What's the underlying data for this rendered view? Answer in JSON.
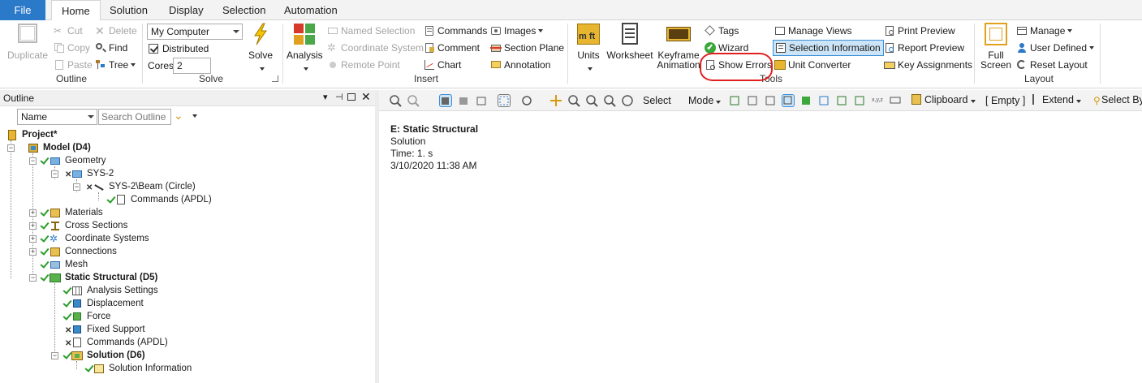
{
  "tabs": [
    "File",
    "Home",
    "Solution",
    "Display",
    "Selection",
    "Automation"
  ],
  "ribbon": {
    "outline_group": {
      "label": "Outline",
      "duplicate": "Duplicate",
      "cut": "Cut",
      "copy": "Copy",
      "paste": "Paste",
      "delete": "Delete",
      "find": "Find",
      "tree": "Tree"
    },
    "solve_group": {
      "label": "Solve",
      "computer_value": "My Computer",
      "distributed_label": "Distributed",
      "distributed_checked": true,
      "cores_label": "Cores",
      "cores_value": "2",
      "solve": "Solve"
    },
    "insert_group": {
      "label": "Insert",
      "analysis": "Analysis",
      "named_selection": "Named Selection",
      "coordinate_system": "Coordinate System",
      "remote_point": "Remote Point",
      "commands": "Commands",
      "comment": "Comment",
      "chart": "Chart",
      "images": "Images",
      "section_plane": "Section Plane",
      "annotation": "Annotation"
    },
    "tools_group": {
      "label": "Tools",
      "units": "Units",
      "worksheet": "Worksheet",
      "keyframe_animation": "Keyframe Animation",
      "tags": "Tags",
      "wizard": "Wizard",
      "show_errors": "Show Errors",
      "manage_views": "Manage Views",
      "selection_information": "Selection Information",
      "unit_converter": "Unit Converter",
      "print_preview": "Print Preview",
      "report_preview": "Report Preview",
      "key_assignments": "Key Assignments"
    },
    "layout_group": {
      "label": "Layout",
      "full_screen": "Full Screen",
      "manage": "Manage",
      "user_defined": "User Defined",
      "reset_layout": "Reset Layout"
    }
  },
  "outline": {
    "title": "Outline",
    "filter_value": "Name",
    "search_placeholder": "Search Outline",
    "tree": [
      {
        "label": "Project*",
        "bold": true
      },
      {
        "label": "Model (D4)",
        "bold": true
      },
      {
        "label": "Geometry"
      },
      {
        "label": "SYS-2"
      },
      {
        "label": "SYS-2\\Beam (Circle)"
      },
      {
        "label": "Commands (APDL)"
      },
      {
        "label": "Materials"
      },
      {
        "label": "Cross Sections"
      },
      {
        "label": "Coordinate Systems"
      },
      {
        "label": "Connections"
      },
      {
        "label": "Mesh"
      },
      {
        "label": "Static Structural (D5)",
        "bold": true
      },
      {
        "label": "Analysis Settings"
      },
      {
        "label": "Displacement"
      },
      {
        "label": "Force"
      },
      {
        "label": "Fixed Support"
      },
      {
        "label": "Commands (APDL)"
      },
      {
        "label": "Solution (D6)",
        "bold": true
      },
      {
        "label": "Solution Information"
      }
    ]
  },
  "view_toolbar": {
    "select": "Select",
    "mode": "Mode",
    "clipboard": "Clipboard",
    "empty": "[ Empty ]",
    "extend": "Extend",
    "select_by": "Select By"
  },
  "worksheet": {
    "title": "E: Static Structural",
    "line1": "Solution",
    "line2": "Time: 1. s",
    "line3": "3/10/2020 11:38 AM"
  },
  "colors": {
    "file_tab": "#2b79c9",
    "highlight": "#cce4f7",
    "annotation_ring": "#e02020",
    "check_green": "#2a9d2a"
  }
}
